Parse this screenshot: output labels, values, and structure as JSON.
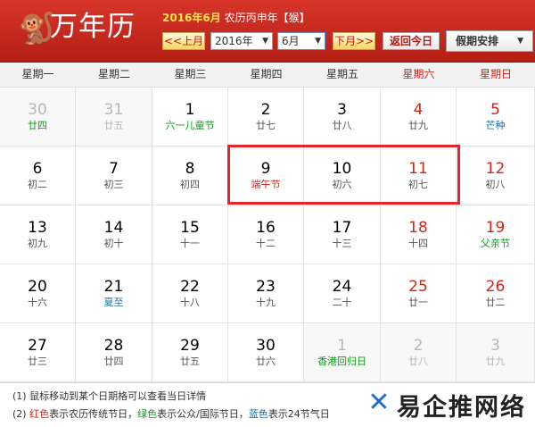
{
  "header": {
    "app_title": "万年历",
    "date_line_year": "2016年6月",
    "date_line_rest": "农历丙申年【猴】",
    "prev_month": "<<上月",
    "year_select": "2016年",
    "month_select": "6月",
    "next_month": "下月>>",
    "today_button": "返回今日",
    "holiday_dropdown": "假期安排"
  },
  "weekdays": [
    "星期一",
    "星期二",
    "星期三",
    "星期四",
    "星期五",
    "星期六",
    "星期日"
  ],
  "days": [
    {
      "num": "30",
      "lunar": "廿四",
      "dim": true,
      "lunar_color": "green"
    },
    {
      "num": "31",
      "lunar": "廿五",
      "dim": true
    },
    {
      "num": "1",
      "lunar": "六一儿童节",
      "lunar_color": "green"
    },
    {
      "num": "2",
      "lunar": "廿七"
    },
    {
      "num": "3",
      "lunar": "廿八"
    },
    {
      "num": "4",
      "lunar": "廿九",
      "num_color": "red"
    },
    {
      "num": "5",
      "lunar": "芒种",
      "num_color": "red",
      "lunar_color": "blue"
    },
    {
      "num": "6",
      "lunar": "初二"
    },
    {
      "num": "7",
      "lunar": "初三"
    },
    {
      "num": "8",
      "lunar": "初四"
    },
    {
      "num": "9",
      "lunar": "端午节",
      "lunar_color": "red"
    },
    {
      "num": "10",
      "lunar": "初六"
    },
    {
      "num": "11",
      "lunar": "初七",
      "num_color": "red"
    },
    {
      "num": "12",
      "lunar": "初八",
      "num_color": "red"
    },
    {
      "num": "13",
      "lunar": "初九"
    },
    {
      "num": "14",
      "lunar": "初十"
    },
    {
      "num": "15",
      "lunar": "十一"
    },
    {
      "num": "16",
      "lunar": "十二"
    },
    {
      "num": "17",
      "lunar": "十三"
    },
    {
      "num": "18",
      "lunar": "十四",
      "num_color": "red"
    },
    {
      "num": "19",
      "lunar": "父亲节",
      "num_color": "red",
      "lunar_color": "green"
    },
    {
      "num": "20",
      "lunar": "十六"
    },
    {
      "num": "21",
      "lunar": "夏至",
      "lunar_color": "blue"
    },
    {
      "num": "22",
      "lunar": "十八"
    },
    {
      "num": "23",
      "lunar": "十九"
    },
    {
      "num": "24",
      "lunar": "二十"
    },
    {
      "num": "25",
      "lunar": "廿一",
      "num_color": "red"
    },
    {
      "num": "26",
      "lunar": "廿二",
      "num_color": "red"
    },
    {
      "num": "27",
      "lunar": "廿三"
    },
    {
      "num": "28",
      "lunar": "廿四"
    },
    {
      "num": "29",
      "lunar": "廿五"
    },
    {
      "num": "30",
      "lunar": "廿六"
    },
    {
      "num": "1",
      "lunar": "香港回归日",
      "dim": true,
      "lunar_color": "green"
    },
    {
      "num": "2",
      "lunar": "廿八",
      "dim": true
    },
    {
      "num": "3",
      "lunar": "廿九",
      "dim": true
    }
  ],
  "footer": {
    "line1": "(1) 鼠标移动到某个日期格可以查看当日详情",
    "line2_prefix": "(2)",
    "red_word": "红色",
    "red_desc": "表示农历传统节日，",
    "green_word": "绿色",
    "green_desc": "表示公众/国际节日，",
    "blue_word": "蓝色",
    "blue_desc": "表示24节气日"
  },
  "watermark": "易企推网络",
  "colors": {
    "header_red": "#c72a1f",
    "holiday_red": "#d0261a",
    "festival_green": "#109b1c",
    "solar_term_blue": "#0e6fae",
    "highlight": "#e5252a"
  }
}
